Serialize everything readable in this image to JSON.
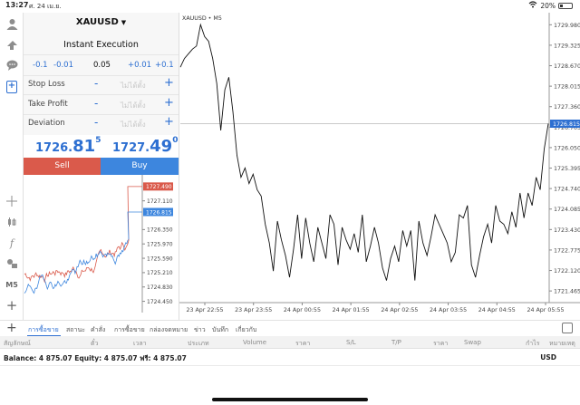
{
  "status_bar": {
    "time": "13:27",
    "date": "ศ. 24 เม.ย.",
    "battery": "20%",
    "battery_level": 0.2
  },
  "toolbar": {
    "items": [
      "account-icon",
      "trade-icon",
      "chat-icon",
      "new-order-icon",
      "crosshair-icon",
      "candlestick-icon",
      "indicator-icon",
      "objects-icon",
      "timeframe-m5",
      "add-icon"
    ],
    "timeframe_label": "M5"
  },
  "order_panel": {
    "symbol": "XAUUSD",
    "caret": "▼",
    "execution": "Instant Execution",
    "steps": [
      "-0.1",
      "-0.01",
      "0.05",
      "+0.01",
      "+0.1"
    ],
    "rows": [
      {
        "label": "Stop Loss",
        "placeholder": "ไม่ได้ตั้ง"
      },
      {
        "label": "Take Profit",
        "placeholder": "ไม่ได้ตั้ง"
      },
      {
        "label": "Deviation",
        "placeholder": "ไม่ได้ตั้ง"
      }
    ],
    "minus": "-",
    "plus": "+",
    "sell_price": {
      "lead": "1726.",
      "big": "81",
      "sup": "5"
    },
    "buy_price": {
      "lead": "1727.",
      "big": "49",
      "sup": "0"
    },
    "sell_label": "Sell",
    "buy_label": "Buy"
  },
  "mini_chart": {
    "ticks": [
      "1727.490",
      "1727.110",
      "1726.815",
      "1726.350",
      "1725.970",
      "1725.590",
      "1725.210",
      "1724.830",
      "1724.450"
    ],
    "ask_label": "1727.490",
    "bid_label": "1726.815",
    "colors": {
      "ask": "#da5a4b",
      "bid": "#3d86de"
    }
  },
  "chart_data": {
    "type": "line",
    "title": "XAUUSD • M5",
    "ylim": [
      1721.15,
      1730.25
    ],
    "y_ticks": [
      "1729.980",
      "1729.325",
      "1728.670",
      "1728.015",
      "1727.360",
      "1726.705",
      "1726.050",
      "1725.395",
      "1724.740",
      "1724.085",
      "1723.430",
      "1722.775",
      "1722.120",
      "1721.465"
    ],
    "current_price_label": "1726.815",
    "current_price": 1726.815,
    "x_ticks": [
      "23 Apr 22:55",
      "23 Apr 23:55",
      "24 Apr 00:55",
      "24 Apr 01:55",
      "24 Apr 02:55",
      "24 Apr 03:55",
      "24 Apr 04:55",
      "24 Apr 05:55"
    ],
    "series": [
      {
        "values": [
          1728.62,
          1728.9,
          1729.05,
          1729.2,
          1729.3,
          1729.98,
          1729.6,
          1729.45,
          1728.9,
          1728.1,
          1726.6,
          1727.9,
          1728.3,
          1727.2,
          1725.8,
          1725.1,
          1725.4,
          1724.9,
          1725.2,
          1724.7,
          1724.5,
          1723.6,
          1723.0,
          1722.1,
          1723.7,
          1723.1,
          1722.6,
          1721.9,
          1722.8,
          1723.9,
          1722.5,
          1723.8,
          1723.0,
          1722.4,
          1723.5,
          1723.0,
          1722.5,
          1723.9,
          1723.6,
          1722.3,
          1723.5,
          1723.1,
          1722.8,
          1723.3,
          1722.7,
          1723.9,
          1722.4,
          1722.9,
          1723.5,
          1723.0,
          1722.2,
          1721.8,
          1722.5,
          1722.9,
          1722.4,
          1723.4,
          1722.9,
          1723.4,
          1721.8,
          1723.7,
          1723.0,
          1722.6,
          1723.2,
          1723.9,
          1723.6,
          1723.3,
          1723.0,
          1722.4,
          1722.7,
          1723.9,
          1723.8,
          1724.2,
          1722.3,
          1721.9,
          1722.6,
          1723.2,
          1723.6,
          1723.0,
          1724.2,
          1723.7,
          1723.6,
          1723.3,
          1724.0,
          1723.5,
          1724.6,
          1723.8,
          1724.6,
          1724.2,
          1725.1,
          1724.7,
          1726.0,
          1726.82
        ]
      }
    ]
  },
  "bottom_tabs": {
    "items": [
      "การซื้อขาย",
      "สถานะ",
      "คำสั่ง",
      "การซื้อขาย",
      "กล่องจดหมาย",
      "ข่าว",
      "บันทึก",
      "เกี่ยวกับ"
    ],
    "active": 0
  },
  "table_headers": [
    "สัญลักษณ์",
    "ตั๋ว",
    "เวลา",
    "ประเภท",
    "Volume",
    "ราคา",
    "S/L",
    "T/P",
    "ราคา",
    "Swap",
    "กำไร",
    "หมายเหตุ"
  ],
  "footer": {
    "balance_text": "Balance: 4 875.07 Equity: 4 875.07 ฟรี: 4 875.07",
    "currency": "USD"
  }
}
